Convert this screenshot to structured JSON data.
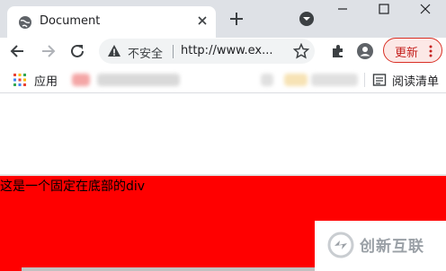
{
  "tab": {
    "title": "Document"
  },
  "address_bar": {
    "security_label": "不安全",
    "url": "http://www.ex..."
  },
  "toolbar": {
    "update_label": "更新"
  },
  "bookmarks_bar": {
    "apps_label": "应用",
    "reading_list_label": "阅读清单"
  },
  "page": {
    "fixed_div_text": "这是一个固定在底部的div",
    "fixed_div_color": "#ff0000"
  },
  "watermark": {
    "text": "创新互联"
  }
}
